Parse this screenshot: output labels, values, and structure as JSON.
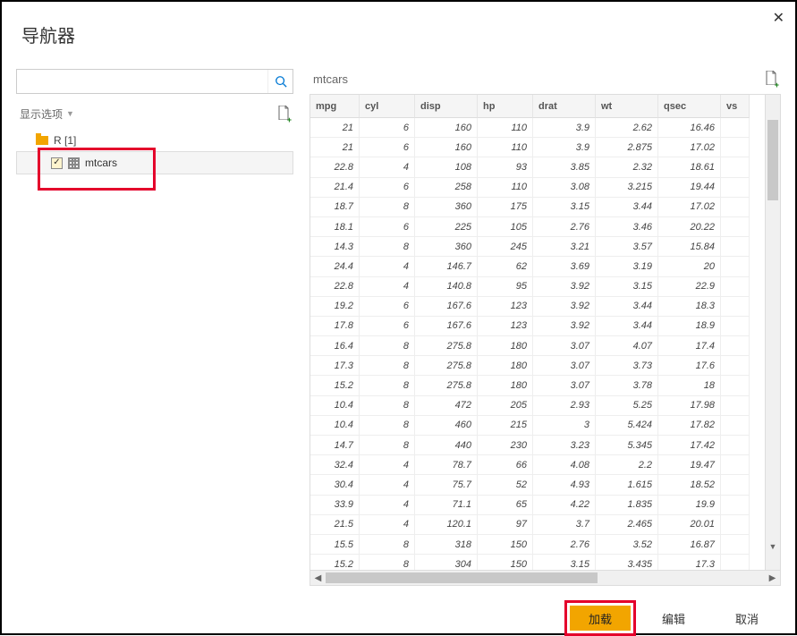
{
  "dialog": {
    "title": "导航器",
    "close_label": "✕"
  },
  "left": {
    "search_placeholder": "",
    "display_options": "显示选项",
    "tree": {
      "root_label": "R [1]",
      "item_label": "mtcars",
      "item_checked": true
    }
  },
  "preview": {
    "title": "mtcars",
    "columns": [
      "mpg",
      "cyl",
      "disp",
      "hp",
      "drat",
      "wt",
      "qsec",
      "vs"
    ]
  },
  "chart_data": {
    "type": "table",
    "columns": [
      "mpg",
      "cyl",
      "disp",
      "hp",
      "drat",
      "wt",
      "qsec"
    ],
    "rows": [
      [
        21,
        6,
        160,
        110,
        3.9,
        2.62,
        16.46
      ],
      [
        21,
        6,
        160,
        110,
        3.9,
        2.875,
        17.02
      ],
      [
        22.8,
        4,
        108,
        93,
        3.85,
        2.32,
        18.61
      ],
      [
        21.4,
        6,
        258,
        110,
        3.08,
        3.215,
        19.44
      ],
      [
        18.7,
        8,
        360,
        175,
        3.15,
        3.44,
        17.02
      ],
      [
        18.1,
        6,
        225,
        105,
        2.76,
        3.46,
        20.22
      ],
      [
        14.3,
        8,
        360,
        245,
        3.21,
        3.57,
        15.84
      ],
      [
        24.4,
        4,
        146.7,
        62,
        3.69,
        3.19,
        20
      ],
      [
        22.8,
        4,
        140.8,
        95,
        3.92,
        3.15,
        22.9
      ],
      [
        19.2,
        6,
        167.6,
        123,
        3.92,
        3.44,
        18.3
      ],
      [
        17.8,
        6,
        167.6,
        123,
        3.92,
        3.44,
        18.9
      ],
      [
        16.4,
        8,
        275.8,
        180,
        3.07,
        4.07,
        17.4
      ],
      [
        17.3,
        8,
        275.8,
        180,
        3.07,
        3.73,
        17.6
      ],
      [
        15.2,
        8,
        275.8,
        180,
        3.07,
        3.78,
        18
      ],
      [
        10.4,
        8,
        472,
        205,
        2.93,
        5.25,
        17.98
      ],
      [
        10.4,
        8,
        460,
        215,
        3,
        5.424,
        17.82
      ],
      [
        14.7,
        8,
        440,
        230,
        3.23,
        5.345,
        17.42
      ],
      [
        32.4,
        4,
        78.7,
        66,
        4.08,
        2.2,
        19.47
      ],
      [
        30.4,
        4,
        75.7,
        52,
        4.93,
        1.615,
        18.52
      ],
      [
        33.9,
        4,
        71.1,
        65,
        4.22,
        1.835,
        19.9
      ],
      [
        21.5,
        4,
        120.1,
        97,
        3.7,
        2.465,
        20.01
      ],
      [
        15.5,
        8,
        318,
        150,
        2.76,
        3.52,
        16.87
      ],
      [
        15.2,
        8,
        304,
        150,
        3.15,
        3.435,
        17.3
      ]
    ]
  },
  "footer": {
    "load": "加载",
    "edit": "编辑",
    "cancel": "取消"
  }
}
